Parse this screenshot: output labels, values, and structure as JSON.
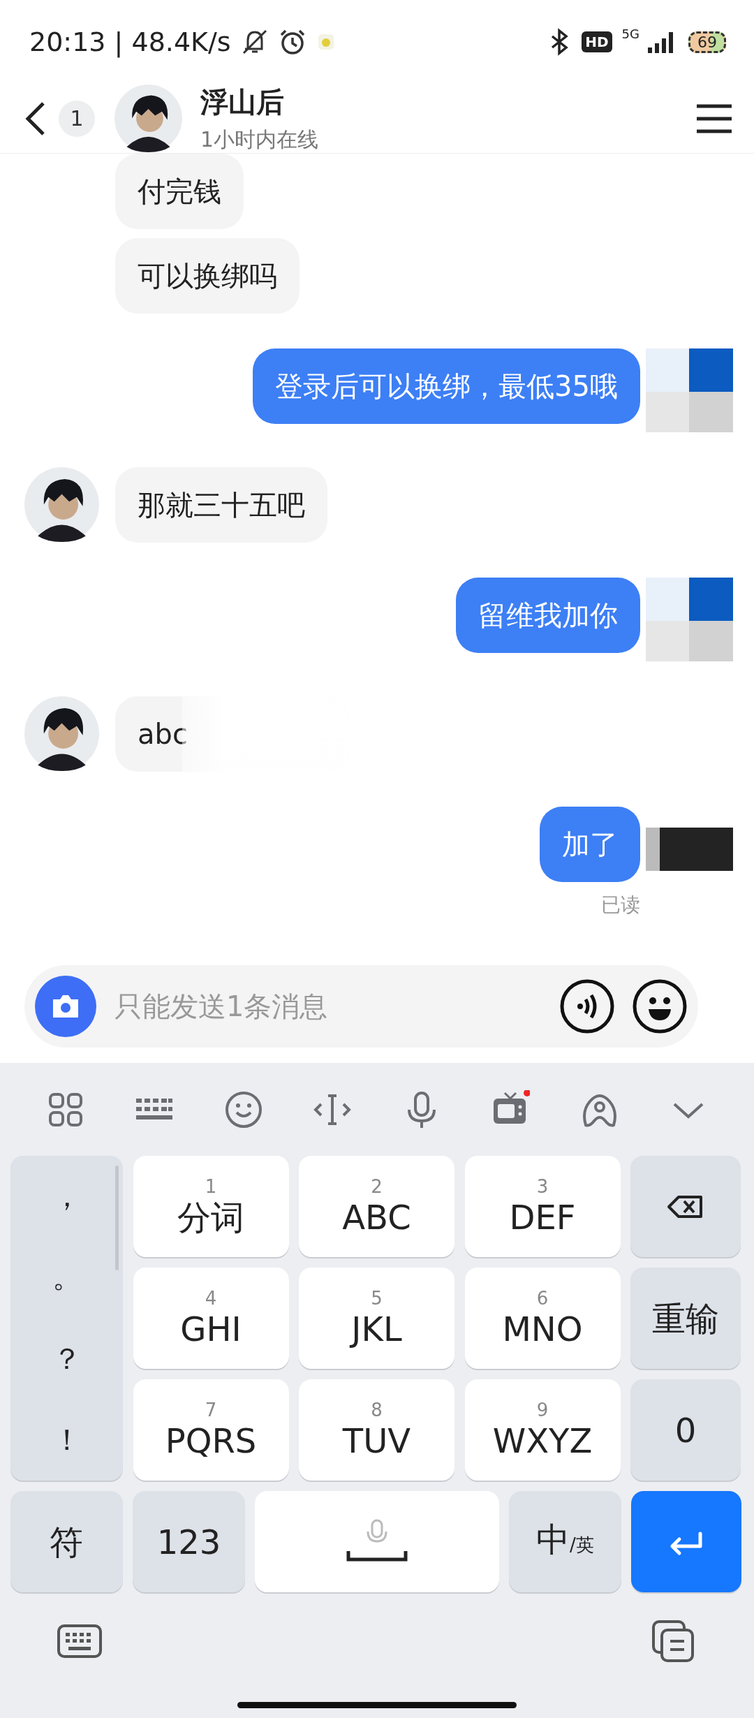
{
  "status_bar": {
    "time_speed": "20:13 | 48.4K/s",
    "hd": "HD",
    "network": "5G",
    "battery": "69"
  },
  "header": {
    "unread": "1",
    "name": "浮山后",
    "presence": "1小时内在线"
  },
  "messages": [
    {
      "kind": "received",
      "text": "付完钱",
      "avatar": false
    },
    {
      "kind": "received",
      "text": "可以换绑吗",
      "avatar": false
    },
    {
      "kind": "sent",
      "text": "登录后可以换绑，最低35哦",
      "cover": {
        "kind": "mosaic"
      }
    },
    {
      "kind": "received",
      "text": "那就三十五吧",
      "avatar": true
    },
    {
      "kind": "sent",
      "text": "留维我加你",
      "cover": {
        "kind": "mosaic"
      }
    },
    {
      "kind": "received",
      "text": "abc",
      "avatar": true,
      "blurred": true
    },
    {
      "kind": "sent",
      "text": "加了",
      "cover": {
        "kind": "dark"
      },
      "receipt": "已读"
    }
  ],
  "input": {
    "placeholder": "只能发送1条消息"
  },
  "toolbar": [
    {
      "kind": "grid",
      "dot": false
    },
    {
      "kind": "keyboard",
      "dot": false
    },
    {
      "kind": "smiley",
      "dot": false
    },
    {
      "kind": "cursor",
      "dot": false
    },
    {
      "kind": "mic",
      "dot": false
    },
    {
      "kind": "tv",
      "dot": true
    },
    {
      "kind": "skin",
      "dot": false
    },
    {
      "kind": "collapse",
      "dot": false
    }
  ],
  "punctuation": [
    "，",
    "。",
    "？",
    "！"
  ],
  "keys": [
    {
      "kind": "letter",
      "digit": "1",
      "label": "分词"
    },
    {
      "kind": "letter",
      "digit": "2",
      "label": "ABC"
    },
    {
      "kind": "letter",
      "digit": "3",
      "label": "DEF"
    },
    {
      "kind": "backspace"
    },
    {
      "kind": "letter",
      "digit": "4",
      "label": "GHI"
    },
    {
      "kind": "letter",
      "digit": "5",
      "label": "JKL"
    },
    {
      "kind": "letter",
      "digit": "6",
      "label": "MNO"
    },
    {
      "kind": "function",
      "label": "重输"
    },
    {
      "kind": "letter",
      "digit": "7",
      "label": "PQRS"
    },
    {
      "kind": "letter",
      "digit": "8",
      "label": "TUV"
    },
    {
      "kind": "letter",
      "digit": "9",
      "label": "WXYZ"
    },
    {
      "kind": "function",
      "label": "0"
    }
  ],
  "bottom_keys": [
    {
      "kind": "function",
      "label": "符"
    },
    {
      "kind": "function",
      "label": "123"
    },
    {
      "kind": "space"
    },
    {
      "kind": "language",
      "label": "中",
      "sub": "/英"
    },
    {
      "kind": "enter"
    }
  ]
}
